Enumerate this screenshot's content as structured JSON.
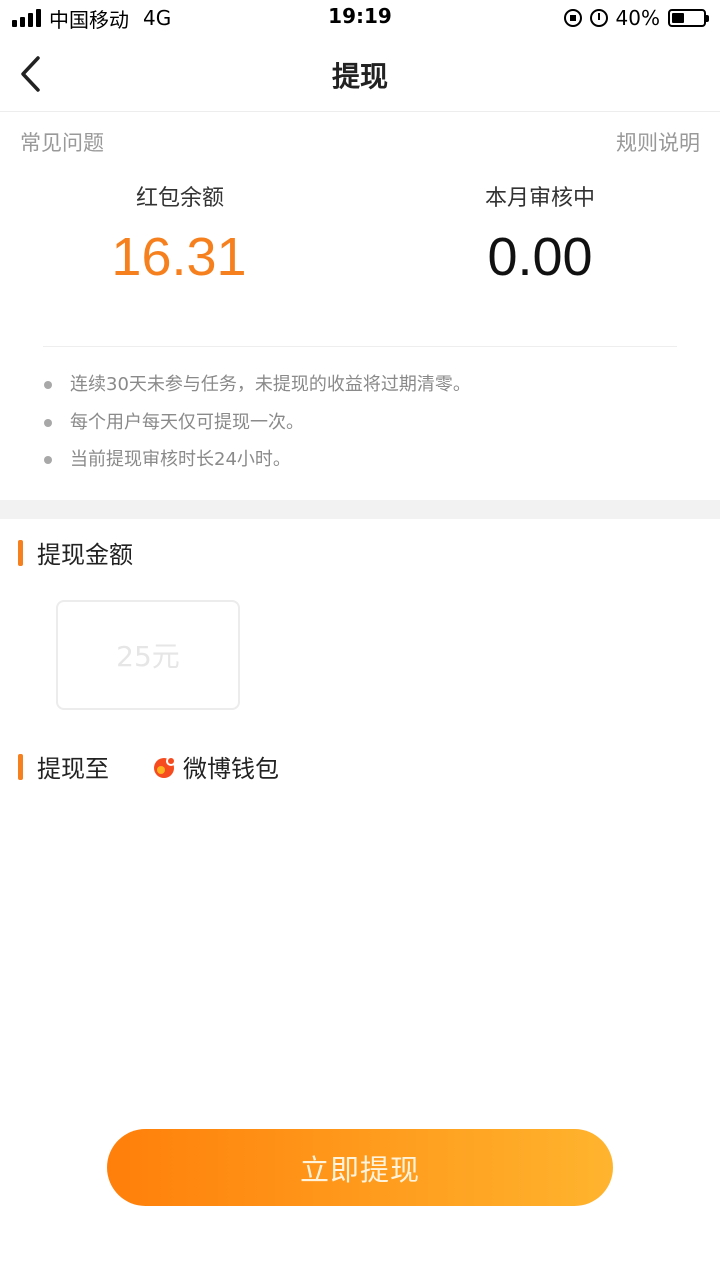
{
  "status_bar": {
    "carrier": "中国移动",
    "network": "4G",
    "time": "19:19",
    "battery_text": "40%",
    "battery_level": 0.4
  },
  "nav": {
    "title": "提现",
    "back_icon": "chevron-left-icon"
  },
  "links": {
    "faq": "常见问题",
    "rules": "规则说明"
  },
  "balance": {
    "label": "红包余额",
    "value": "16.31",
    "color": "#f6801e"
  },
  "review": {
    "label": "本月审核中",
    "value": "0.00"
  },
  "notes": [
    "连续30天未参与任务，未提现的收益将过期清零。",
    "每个用户每天仅可提现一次。",
    "当前提现审核时长24小时。"
  ],
  "amount_section": {
    "title": "提现金额",
    "options": [
      "25元"
    ]
  },
  "destination_section": {
    "title": "提现至",
    "wallet_name": "微博钱包",
    "wallet_icon": "weibo-wallet-icon"
  },
  "cta": {
    "label": "立即提现",
    "gradient": [
      "#ff7f0a",
      "#ffb42e"
    ]
  }
}
